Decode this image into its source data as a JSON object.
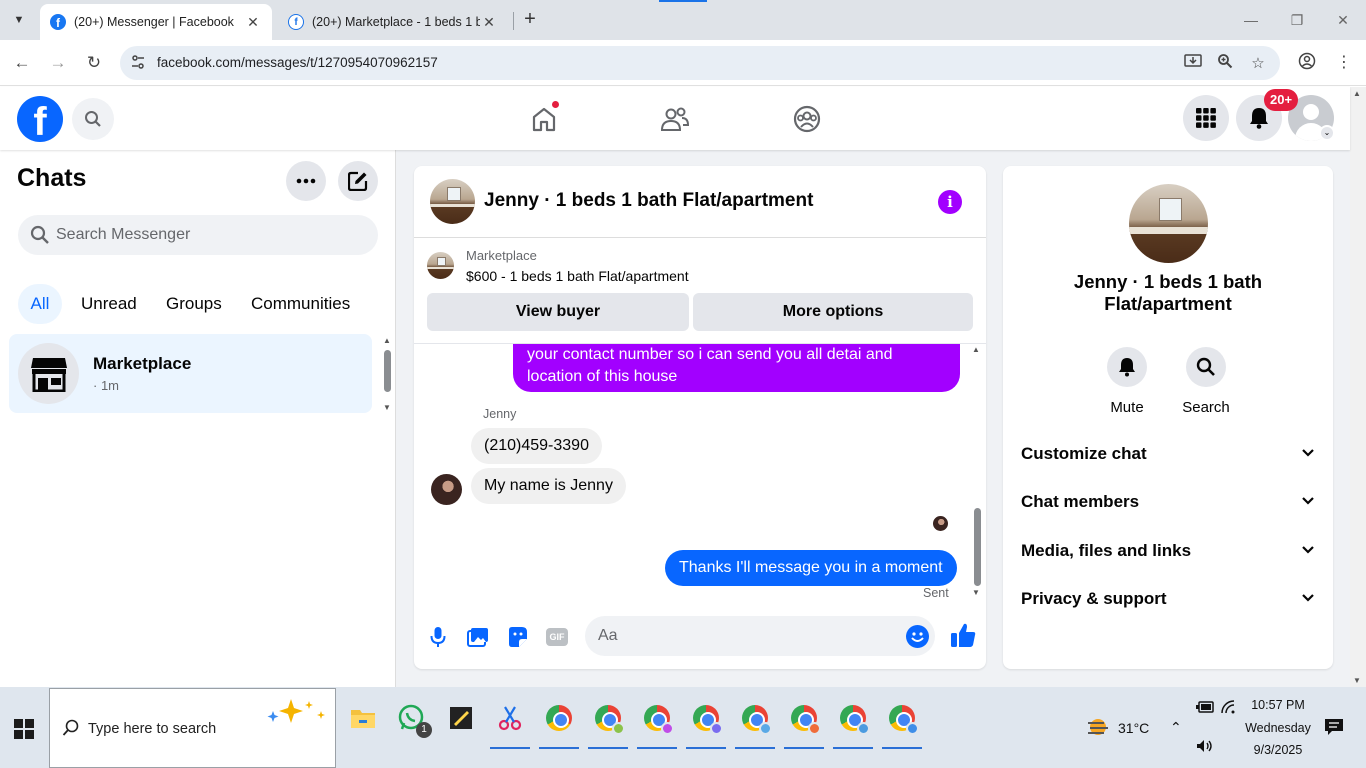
{
  "browser": {
    "tabs": [
      {
        "title": "(20+) Messenger | Facebook",
        "active": true
      },
      {
        "title": "(20+) Marketplace - 1 beds 1 b",
        "active": false
      }
    ],
    "url": "facebook.com/messages/t/1270954070962157",
    "icons": [
      "tab-search-icon",
      "close-icon",
      "new-tab-icon",
      "minimize-icon",
      "maximize-icon",
      "back-icon",
      "forward-icon",
      "reload-icon",
      "site-info-icon",
      "install-icon",
      "zoom-icon",
      "star-icon",
      "profile-icon",
      "menu-icon"
    ]
  },
  "header": {
    "notif_badge": "20+",
    "icons": [
      "facebook-logo-icon",
      "search-icon",
      "home-icon",
      "friends-icon",
      "groups-icon",
      "apps-grid-icon",
      "bell-icon",
      "avatar"
    ]
  },
  "chats": {
    "title": "Chats",
    "search_placeholder": "Search Messenger",
    "filters": [
      "All",
      "Unread",
      "Groups",
      "Communities"
    ],
    "active_filter": "All",
    "items": [
      {
        "name": "Marketplace",
        "meta": "· 1m"
      }
    ]
  },
  "conversation": {
    "title": "Jenny · 1 beds 1 bath Flat/apartment",
    "marketplace_label": "Marketplace",
    "listing_price": "$600 - 1 beds 1 bath Flat/apartment",
    "view_buyer": "View buyer",
    "more_options": "More options",
    "messages": {
      "outgoing_partial": "your contact number so i can send you all detai and location of this house",
      "sender_name": "Jenny",
      "incoming": [
        "(210)459-3390",
        "My name is Jenny"
      ],
      "outgoing": "Thanks I'll message you in a moment",
      "status": "Sent"
    },
    "composer_placeholder": "Aa",
    "accent": "#a200ff"
  },
  "info_panel": {
    "name": "Jenny · 1 beds 1 bath Flat/apartment",
    "actions": [
      "Mute",
      "Search"
    ],
    "sections": [
      "Customize chat",
      "Chat members",
      "Media, files and links",
      "Privacy & support"
    ]
  },
  "taskbar": {
    "search_placeholder": "Type here to search",
    "weather": "31°C",
    "time": "10:57 PM",
    "day": "Wednesday",
    "date": "9/3/2025",
    "whatsapp_badge": "1"
  },
  "colors": {
    "facebook_blue": "#0866ff",
    "notification_red": "#e41e3f",
    "purple_bubble": "#a200ff",
    "blue_bubble": "#0866ff"
  }
}
